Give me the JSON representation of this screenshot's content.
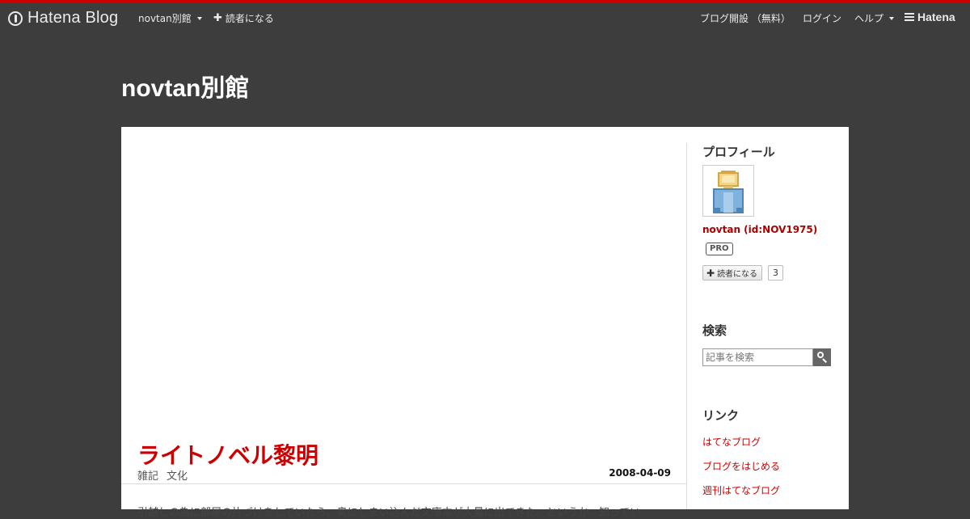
{
  "global_header": {
    "logo_text": "Hatena Blog",
    "blog_menu_label": "novtan別館",
    "subscribe_label": "読者になる",
    "open_blog_label": "ブログ開設 （無料）",
    "login_label": "ログイン",
    "help_label": "ヘルプ",
    "hatena_label": "Hatena",
    "accent_color": "#cc0000"
  },
  "blog": {
    "title": "novtan別館"
  },
  "entry": {
    "title": "ライトノベル黎明",
    "categories": [
      "雑記",
      "文化"
    ],
    "date": "2008-04-09",
    "excerpt": "引越しの為に部屋の片づけをしていたら、奥にしまい込んだ文庫本が大量に出てきた。というか、知ってい"
  },
  "sidebar": {
    "profile": {
      "heading": "プロフィール",
      "name": "novtan (id:NOV1975)",
      "badge": "PRO",
      "subscribe_label": "読者になる",
      "subscriber_count": "3"
    },
    "search": {
      "heading": "検索",
      "placeholder": "記事を検索"
    },
    "links": {
      "heading": "リンク",
      "items": [
        "はてなブログ",
        "ブログをはじめる",
        "週刊はてなブログ"
      ]
    }
  }
}
